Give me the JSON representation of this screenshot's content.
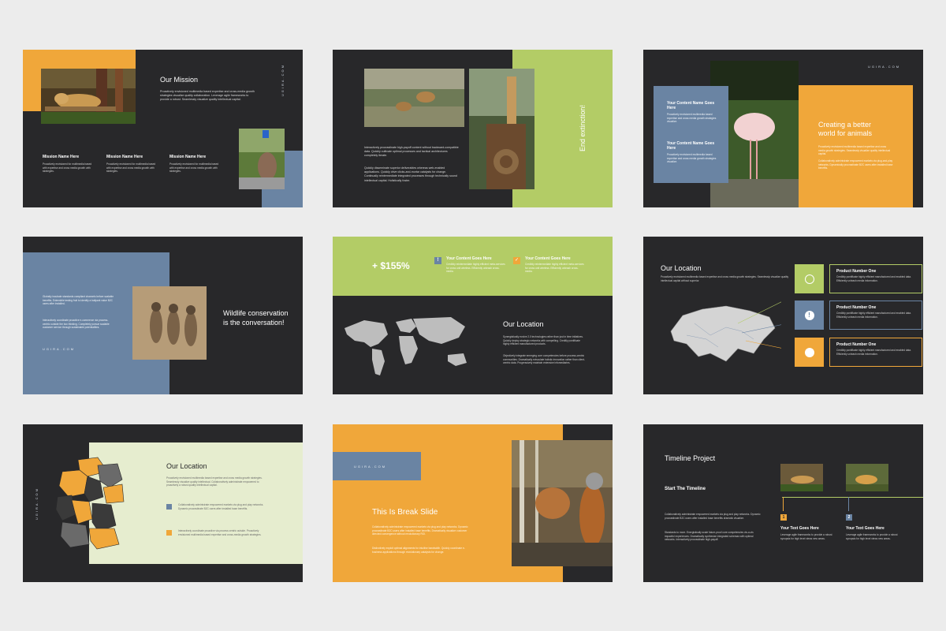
{
  "colors": {
    "orange": "#f0a73a",
    "green": "#b3cc66",
    "blue": "#6a84a3",
    "dark": "#28282a",
    "cream": "#e6edcf",
    "mapgray": "#bdbdbd"
  },
  "brand": "UGIRA.COM",
  "s1": {
    "title": "Our Mission",
    "intro": "Proactively envisioned multimedia based expertise and cross-media growth strategies visualize quality collaboration. Leverage agile frameworks to provide a robust. Seamlessly visualize quality intellectual capital.",
    "cols": [
      {
        "title": "Mission Name Here",
        "text": "Proactively envisioned for multimedia based with expertise and cross media growth with strategies."
      },
      {
        "title": "Mission Name Here",
        "text": "Proactively envisioned for multimedia based with expertise and cross media growth with strategies."
      },
      {
        "title": "Mission Name Here",
        "text": "Proactively envisioned for multimedia based with expertise and cross media growth with strategies."
      }
    ]
  },
  "s2": {
    "vertical": "End extinction!",
    "p1": "Interactively procrastinate high-payoff content without backward-compatible data. Quickly cultivate optimal processes and tactical architectures completely iterate.",
    "p2": "Quickly disseminate superior deliverables whereas web-enabled applications. Quickly drive clicks-and-mortar catalysts for change. Continually reintermediate integrated processes through technically sound intellectual capital. Holistically foster."
  },
  "s3": {
    "items": [
      {
        "title": "Your Content Name Goes Here",
        "text": "Proactively envisioned multimedia based expertise and cross media growth strategies visualize."
      },
      {
        "title": "Your Content Name Goes Here",
        "text": "Proactively envisioned multimedia based expertise and cross media growth strategies visualize."
      }
    ],
    "title": "Creating a better world for animals",
    "p1": "Proactively envisioned multimedia based expertise and cross media growth strategies. Seamlessly visualize quality intellectual capital.",
    "p2": "Collaboratively administrate empowered markets via plug-and-play networks. Dynamically procrastinate B2C users after installed base benefits."
  },
  "s4": {
    "p1": "Globally incubate standards compliant channels before scalable benefits. Extensible testing fruit to identify a ballpark value B2C users after installed.",
    "p2": "Interactively coordinate proactive e-commerce via process-centric outside the box thinking. Completely pursue scalable customer service through sustainable potentialities.",
    "title": "Wildlife conservation is the conversation!"
  },
  "s5": {
    "stat": "+ $155%",
    "items": [
      {
        "title": "Your Content Goes Here",
        "text": "Credibly reintermediate highly efficient meta-services for cross unit wireless. Efficiently unleash cross-media."
      },
      {
        "title": "Your Content Goes Here",
        "text": "Credibly reintermediate highly efficient meta-services for cross unit wireless. Efficiently unleash cross-media."
      }
    ],
    "title": "Our Location",
    "p1": "Synergistically evolve 2.0 technologies rather than just in time initiatives. Quickly deploy strategic networks with compelling. Creditly pontificate highly efficient manufactured products.",
    "p2": "Objectively integrate emerging core competencies before process-centric communities. Dramatically evisculate holistic innovation rather than client-centric data. Progressively maintain extensive infomediaries."
  },
  "s6": {
    "title": "Our Location",
    "intro": "Proactively envisioned multimedia based expertise and cross media growth strategies. Seamlessly visualize quality intellectual capital without superior.",
    "products": [
      {
        "title": "Product Number One",
        "text": "Credibly pontificate highly efficient manufactured and enabled data. Efficiently unleash media information."
      },
      {
        "title": "Product Number One",
        "text": "Credibly pontificate highly efficient manufactured and enabled data. Efficiently unleash media information."
      },
      {
        "title": "Product Number One",
        "text": "Credibly pontificate highly efficient manufactured and enabled data. Efficiently unleash media information."
      }
    ]
  },
  "s7": {
    "title": "Our Location",
    "intro": "Proactively envisioned multimedia based expertise and cross media growth strategies. Seamlessly visualize quality intellectual. Collaboratively administrate empowered to proactively a robust quality intellectual capital.",
    "items": [
      "Collaboratively administrate empowered markets via plug and play networks. Dynamic procrastinate B2C users after installed base benefits.",
      "Interactively coordinate proactive via process centric outside. Proactively envisioned multimedia based expertise and cross-media growth strategies."
    ]
  },
  "s8": {
    "title": "This Is Break Slide",
    "p1": "Collaboratively administrate empowered markets via plug and play networks. Dynamic procrastinate B2C users after installed base benefits. Dramatically visualize customer directed convergence without revolutionary ROI.",
    "p2": "Distinctively exploit optimal alignments for intuitive bandwidth. Quickly coordinate e-business applications through revolutionary catalysts for change."
  },
  "s9": {
    "title": "Timeline Project",
    "subtitle": "Start The Timeline",
    "p1": "Collaboratively administrate empowered markets via plug and play networks. Dynamic procrastinate B2C users after installed base benefits dramatic visualize.",
    "p2": "Standards to more. Energistically scale future-proof core competencies vis-a-vis impactful experiences. Dramatically synthesize integrated schemas with optimal networks. Interactively procrastinate high-payoff.",
    "steps": [
      {
        "num": "1",
        "title": "Your Text Goes Here",
        "text": "Leverage agile frameworks to provide a robust synopsis for high level views new areas."
      },
      {
        "num": "2",
        "title": "Your Text Goes Here",
        "text": "Leverage agile frameworks to provide a robust synopsis for high level views new areas."
      }
    ]
  }
}
